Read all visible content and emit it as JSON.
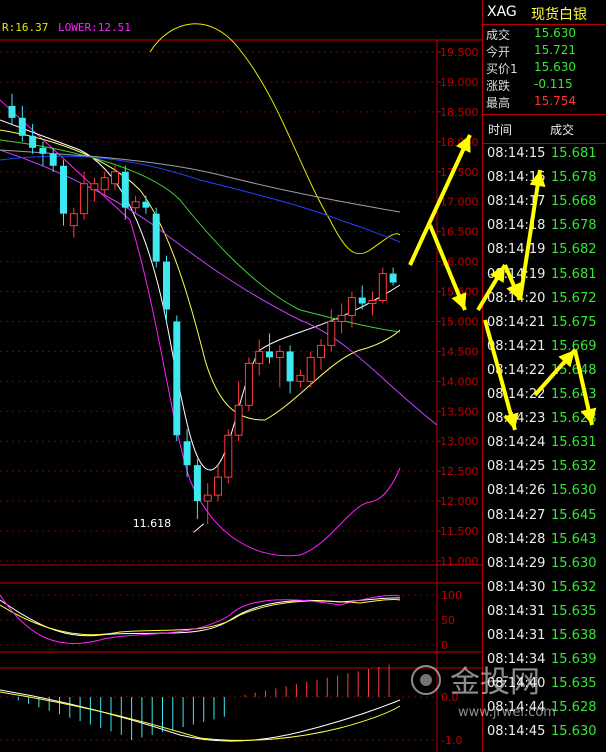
{
  "chart": {
    "legend_upper_text": "R:16.37",
    "legend_lower_text": "LOWER:12.51",
    "low_annotation": "11.618",
    "price_axis_ticks": [
      "19.500",
      "19.000",
      "18.500",
      "18.000",
      "17.500",
      "17.000",
      "16.500",
      "16.000",
      "15.500",
      "15.000",
      "14.500",
      "14.000",
      "13.500",
      "13.000",
      "12.500",
      "12.000",
      "11.500",
      "11.000"
    ],
    "osc1_ticks": [
      "100",
      "50",
      "0"
    ],
    "osc2_ticks": [
      "0.0",
      "-1.0"
    ],
    "candles": [
      {
        "o": 18.6,
        "h": 18.8,
        "l": 18.3,
        "c": 18.4
      },
      {
        "o": 18.4,
        "h": 18.6,
        "l": 18.0,
        "c": 18.1
      },
      {
        "o": 18.1,
        "h": 18.3,
        "l": 17.8,
        "c": 17.9
      },
      {
        "o": 17.9,
        "h": 18.0,
        "l": 17.6,
        "c": 17.8
      },
      {
        "o": 17.8,
        "h": 17.9,
        "l": 17.5,
        "c": 17.6
      },
      {
        "o": 17.6,
        "h": 17.7,
        "l": 16.6,
        "c": 16.8
      },
      {
        "o": 16.6,
        "h": 16.9,
        "l": 16.4,
        "c": 16.8
      },
      {
        "o": 16.8,
        "h": 17.5,
        "l": 16.7,
        "c": 17.3
      },
      {
        "o": 17.2,
        "h": 17.4,
        "l": 17.0,
        "c": 17.3
      },
      {
        "o": 17.2,
        "h": 17.5,
        "l": 17.1,
        "c": 17.4
      },
      {
        "o": 17.3,
        "h": 17.6,
        "l": 17.2,
        "c": 17.5
      },
      {
        "o": 17.5,
        "h": 17.6,
        "l": 16.7,
        "c": 16.9
      },
      {
        "o": 16.9,
        "h": 17.1,
        "l": 16.8,
        "c": 17.0
      },
      {
        "o": 17.0,
        "h": 17.1,
        "l": 16.8,
        "c": 16.9
      },
      {
        "o": 16.8,
        "h": 16.9,
        "l": 15.9,
        "c": 16.0
      },
      {
        "o": 16.0,
        "h": 16.1,
        "l": 15.0,
        "c": 15.2
      },
      {
        "o": 15.0,
        "h": 15.1,
        "l": 13.0,
        "c": 13.1
      },
      {
        "o": 13.0,
        "h": 13.2,
        "l": 12.4,
        "c": 12.6
      },
      {
        "o": 12.6,
        "h": 12.7,
        "l": 11.7,
        "c": 12.0
      },
      {
        "o": 12.0,
        "h": 12.3,
        "l": 11.62,
        "c": 12.1
      },
      {
        "o": 12.1,
        "h": 12.6,
        "l": 12.0,
        "c": 12.4
      },
      {
        "o": 12.4,
        "h": 13.2,
        "l": 12.3,
        "c": 13.1
      },
      {
        "o": 13.1,
        "h": 14.0,
        "l": 13.0,
        "c": 13.6
      },
      {
        "o": 13.6,
        "h": 14.4,
        "l": 13.5,
        "c": 14.3
      },
      {
        "o": 14.3,
        "h": 14.7,
        "l": 14.1,
        "c": 14.5
      },
      {
        "o": 14.5,
        "h": 14.8,
        "l": 14.3,
        "c": 14.4
      },
      {
        "o": 14.4,
        "h": 14.6,
        "l": 13.9,
        "c": 14.5
      },
      {
        "o": 14.5,
        "h": 14.6,
        "l": 13.8,
        "c": 14.0
      },
      {
        "o": 14.0,
        "h": 14.2,
        "l": 13.9,
        "c": 14.1
      },
      {
        "o": 14.0,
        "h": 14.5,
        "l": 13.9,
        "c": 14.4
      },
      {
        "o": 14.4,
        "h": 14.7,
        "l": 14.2,
        "c": 14.6
      },
      {
        "o": 14.6,
        "h": 15.2,
        "l": 14.5,
        "c": 15.0
      },
      {
        "o": 15.0,
        "h": 15.3,
        "l": 14.8,
        "c": 15.1
      },
      {
        "o": 15.1,
        "h": 15.5,
        "l": 14.9,
        "c": 15.4
      },
      {
        "o": 15.4,
        "h": 15.6,
        "l": 15.2,
        "c": 15.3
      },
      {
        "o": 15.3,
        "h": 15.5,
        "l": 15.1,
        "c": 15.35
      },
      {
        "o": 15.35,
        "h": 15.9,
        "l": 15.3,
        "c": 15.8
      },
      {
        "o": 15.8,
        "h": 15.9,
        "l": 15.6,
        "c": 15.65
      }
    ]
  },
  "quote": {
    "symbol": "XAG",
    "name": "现货白银",
    "rows": [
      {
        "label": "成交",
        "value": "15.630",
        "color": "#35e635"
      },
      {
        "label": "今开",
        "value": "15.721",
        "color": "#35e635"
      },
      {
        "label": "买价1",
        "value": "15.630",
        "color": "#35e635"
      },
      {
        "label": "涨跌",
        "value": "-0.115",
        "color": "#35e635"
      },
      {
        "label": "最高",
        "value": "15.754",
        "color": "#ff3030"
      }
    ],
    "trade_header_time": "时间",
    "trade_header_price": "成交",
    "trades": [
      {
        "time": "08:14:15",
        "price": "15.681"
      },
      {
        "time": "08:14:16",
        "price": "15.678"
      },
      {
        "time": "08:14:17",
        "price": "15.668"
      },
      {
        "time": "08:14:18",
        "price": "15.678"
      },
      {
        "time": "08:14:19",
        "price": "15.682"
      },
      {
        "time": "08:14:19",
        "price": "15.681"
      },
      {
        "time": "08:14:20",
        "price": "15.672"
      },
      {
        "time": "08:14:21",
        "price": "15.675"
      },
      {
        "time": "08:14:21",
        "price": "15.669"
      },
      {
        "time": "08:14:22",
        "price": "15.648"
      },
      {
        "time": "08:14:22",
        "price": "15.643"
      },
      {
        "time": "08:14:23",
        "price": "15.628"
      },
      {
        "time": "08:14:24",
        "price": "15.631"
      },
      {
        "time": "08:14:25",
        "price": "15.632"
      },
      {
        "time": "08:14:26",
        "price": "15.630"
      },
      {
        "time": "08:14:27",
        "price": "15.645"
      },
      {
        "time": "08:14:28",
        "price": "15.643"
      },
      {
        "time": "08:14:29",
        "price": "15.630"
      },
      {
        "time": "08:14:30",
        "price": "15.632"
      },
      {
        "time": "08:14:31",
        "price": "15.635"
      },
      {
        "time": "08:14:31",
        "price": "15.638"
      },
      {
        "time": "08:14:34",
        "price": "15.639"
      },
      {
        "time": "08:14:40",
        "price": "15.635"
      },
      {
        "time": "08:14:44",
        "price": "15.628"
      },
      {
        "time": "08:14:45",
        "price": "15.630"
      }
    ]
  },
  "watermark": {
    "logo_text": "金投网",
    "url": "www.jrwei.com"
  },
  "colors": {
    "up": "#ff3b3b",
    "down": "#3de8f0",
    "axis": "#c00000",
    "price_green": "#35e635",
    "arrow": "#ffff00",
    "upper_label": "#e8e800",
    "lower_label": "#ff20ff"
  }
}
